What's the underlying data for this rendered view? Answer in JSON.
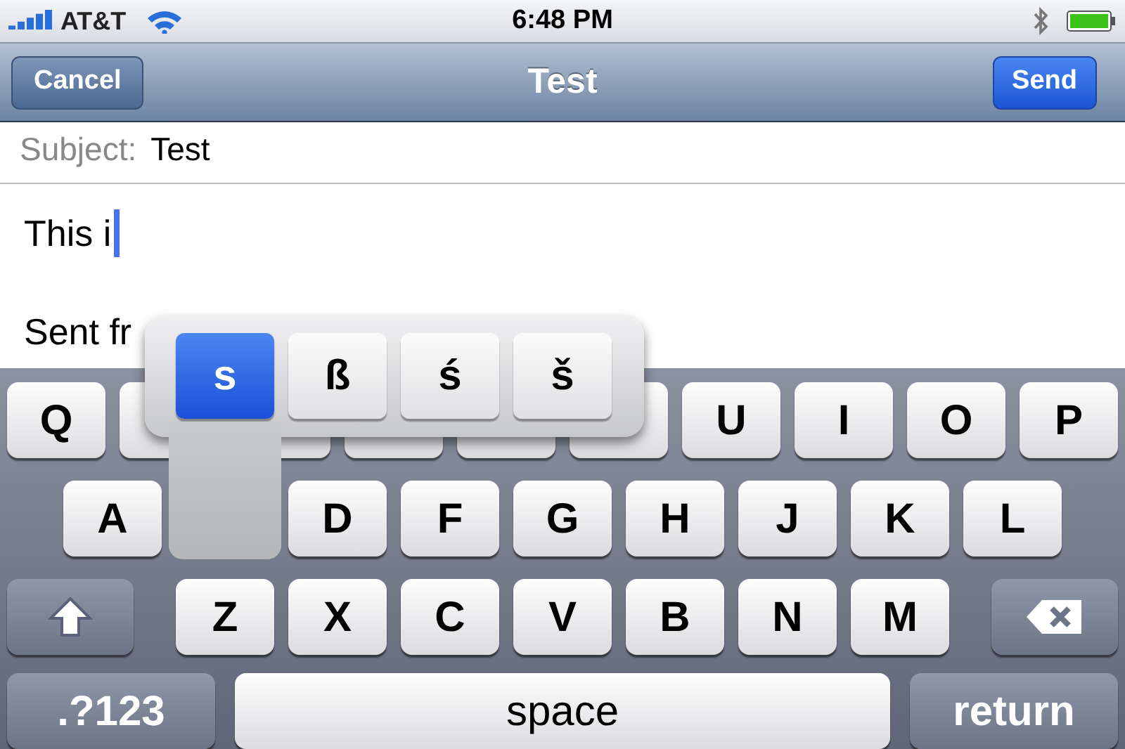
{
  "status_bar": {
    "carrier": "AT&T",
    "time": "6:48 PM"
  },
  "nav_bar": {
    "cancel": "Cancel",
    "title": "Test",
    "send": "Send"
  },
  "subject": {
    "label": "Subject:",
    "value": "Test"
  },
  "body": {
    "lines": [
      "This i",
      "Sent fr"
    ]
  },
  "keyboard": {
    "rows": [
      [
        {
          "kind": "letter",
          "label": "Q"
        },
        {
          "kind": "covered"
        },
        {
          "kind": "covered"
        },
        {
          "kind": "covered"
        },
        {
          "kind": "covered"
        },
        {
          "kind": "covered"
        },
        {
          "kind": "letter",
          "label": "U"
        },
        {
          "kind": "letter",
          "label": "I"
        },
        {
          "kind": "letter",
          "label": "O"
        },
        {
          "kind": "letter",
          "label": "P"
        }
      ],
      [
        {
          "kind": "letter",
          "label": "A"
        },
        {
          "kind": "spacer"
        },
        {
          "kind": "letter",
          "label": "D"
        },
        {
          "kind": "letter",
          "label": "F"
        },
        {
          "kind": "letter",
          "label": "G"
        },
        {
          "kind": "letter",
          "label": "H"
        },
        {
          "kind": "letter",
          "label": "J"
        },
        {
          "kind": "letter",
          "label": "K"
        },
        {
          "kind": "letter",
          "label": "L"
        }
      ],
      [
        {
          "kind": "shift"
        },
        {
          "kind": "letter",
          "label": "Z"
        },
        {
          "kind": "letter",
          "label": "X"
        },
        {
          "kind": "letter",
          "label": "C"
        },
        {
          "kind": "letter",
          "label": "V"
        },
        {
          "kind": "letter",
          "label": "B"
        },
        {
          "kind": "letter",
          "label": "N"
        },
        {
          "kind": "letter",
          "label": "M"
        },
        {
          "kind": "delete"
        }
      ]
    ],
    "bottom_row": {
      "numbers": ".?123",
      "space": "space",
      "return": "return"
    },
    "alternates": [
      {
        "label": "s",
        "selected": true
      },
      {
        "label": "ß",
        "selected": false
      },
      {
        "label": "ś",
        "selected": false
      },
      {
        "label": "š",
        "selected": false
      }
    ]
  }
}
